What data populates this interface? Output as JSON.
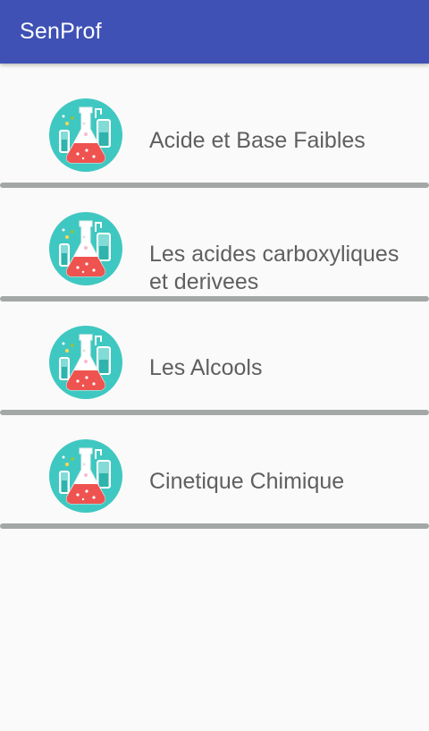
{
  "app_bar": {
    "title": "SenProf",
    "color": "#3f51b5"
  },
  "items": [
    {
      "label": "Acide et Base Faibles",
      "icon": "chemistry-flask-icon"
    },
    {
      "label": "Les acides carboxyliques et derivees",
      "icon": "chemistry-flask-icon"
    },
    {
      "label": "Les Alcools",
      "icon": "chemistry-flask-icon"
    },
    {
      "label": "Cinetique Chimique",
      "icon": "chemistry-flask-icon"
    }
  ]
}
